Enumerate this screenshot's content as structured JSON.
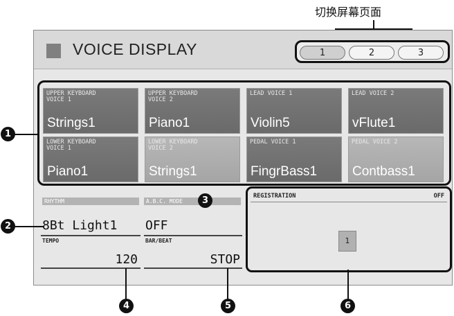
{
  "callout_top": "切换屏幕页面",
  "header": {
    "title": "VOICE DISPLAY",
    "pages": [
      "1",
      "2",
      "3"
    ]
  },
  "voices": [
    {
      "label_line1": "UPPER KEYBOARD",
      "label_line2": "VOICE 1",
      "value": "Strings1"
    },
    {
      "label_line1": "UPPER KEYBOARD",
      "label_line2": "VOICE 2",
      "value": "Piano1"
    },
    {
      "label_line1": "LEAD VOICE 1",
      "label_line2": "",
      "value": "Violin5"
    },
    {
      "label_line1": "LEAD VOICE 2",
      "label_line2": "",
      "value": "vFlute1"
    },
    {
      "label_line1": "LOWER KEYBOARD",
      "label_line2": "VOICE 1",
      "value": "Piano1"
    },
    {
      "label_line1": "LOWER KEYBOARD",
      "label_line2": "VOICE 2",
      "value": "Strings1"
    },
    {
      "label_line1": "PEDAL VOICE 1",
      "label_line2": "",
      "value": "FingrBass1"
    },
    {
      "label_line1": "PEDAL VOICE 2",
      "label_line2": "",
      "value": "Contbass1"
    }
  ],
  "rhythm": {
    "label": "RHYTHM",
    "value": "8Bt Light1"
  },
  "abc_mode": {
    "label": "A.B.C. MODE",
    "value": "OFF"
  },
  "tempo": {
    "label": "TEMPO",
    "value": "120"
  },
  "bar_beat": {
    "label": "BAR/BEAT",
    "value": "STOP"
  },
  "registration": {
    "label": "REGISTRATION",
    "status": "OFF",
    "button": "1"
  },
  "callouts": [
    "1",
    "2",
    "3",
    "4",
    "5",
    "6"
  ]
}
